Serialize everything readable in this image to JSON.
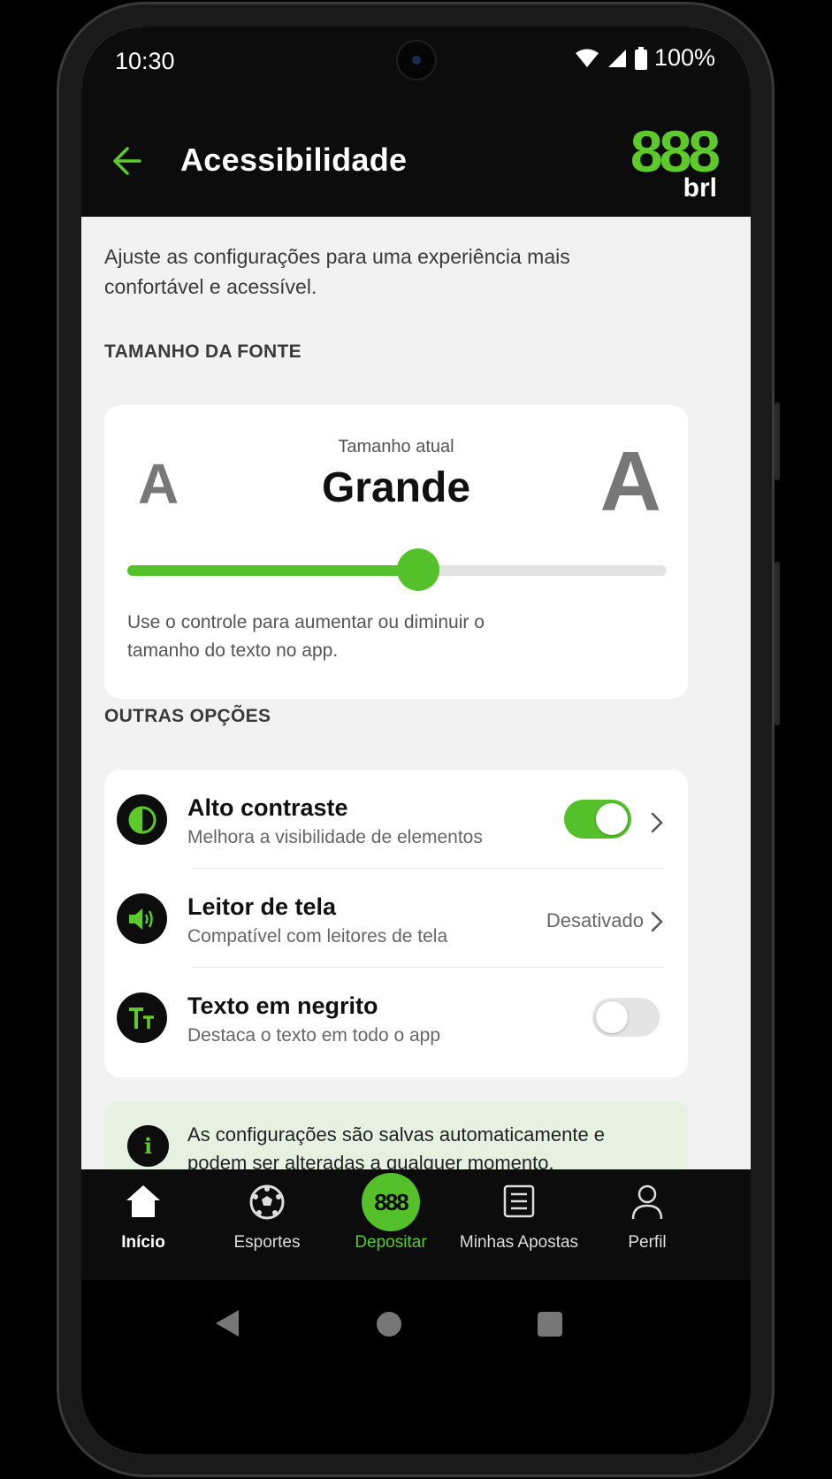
{
  "status_bar": {
    "time": "10:30",
    "battery": "100%"
  },
  "app_bar": {
    "title": "Acessibilidade",
    "logo_number": "888",
    "logo_suffix": "brl"
  },
  "intro": "Ajuste as configurações para uma experiência mais confortável e acessível.",
  "font_section": {
    "label": "TAMANHO DA FONTE",
    "small_a": "A",
    "large_a": "A",
    "current_label": "Tamanho atual",
    "current_value": "Grande",
    "slider_fraction": 0.54,
    "hint": "Use o controle para aumentar ou diminuir o tamanho do texto no app."
  },
  "options_section": {
    "label": "OUTRAS OPÇÕES",
    "items": [
      {
        "title": "Alto contraste",
        "description": "Melhora a visibilidade de elementos",
        "icon": "contrast-icon",
        "toggle": true
      },
      {
        "title": "Leitor de tela",
        "description": "Compatível com leitores de tela",
        "icon": "speaker-icon",
        "value": "Desativado"
      },
      {
        "title": "Texto em negrito",
        "description": "Destaca o texto em todo o app",
        "icon": "text-size-icon",
        "toggle": false
      }
    ]
  },
  "info": {
    "icon": "info-icon",
    "text": "As configurações são salvas automaticamente e podem ser alteradas a qualquer momento."
  },
  "bottom_nav": {
    "items": [
      {
        "label": "Início",
        "icon": "home-icon"
      },
      {
        "label": "Esportes",
        "icon": "soccer-ball-icon"
      },
      {
        "label": "Depositar",
        "icon": "deposit-888-icon",
        "badge": "888"
      },
      {
        "label": "Minhas Apostas",
        "icon": "bets-list-icon"
      },
      {
        "label": "Perfil",
        "icon": "profile-icon"
      }
    ]
  },
  "colors": {
    "accent": "#54c12a",
    "brand_green": "#5ec92a",
    "dark": "#0c0c0c",
    "background": "#f2f2f2",
    "info_background": "#e7f1e2"
  }
}
